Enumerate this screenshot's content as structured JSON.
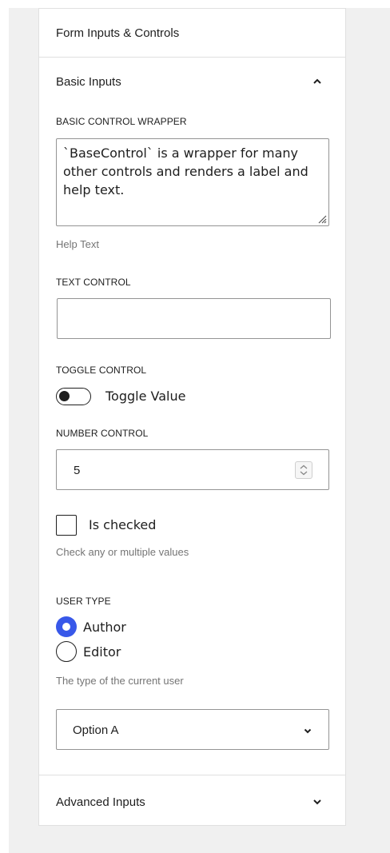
{
  "panel": {
    "title": "Form Inputs & Controls"
  },
  "basic_inputs": {
    "title": "Basic Inputs",
    "expanded": true,
    "base_control": {
      "label": "BASIC CONTROL WRAPPER",
      "value": "`BaseControl` is a wrapper for many other controls and renders a label and help text.",
      "help": "Help Text"
    },
    "text_control": {
      "label": "TEXT CONTROL",
      "value": ""
    },
    "toggle_control": {
      "label": "TOGGLE CONTROL",
      "toggle_label": "Toggle Value",
      "checked": false
    },
    "number_control": {
      "label": "NUMBER CONTROL",
      "value": "5"
    },
    "checkbox": {
      "label": "Is checked",
      "help": "Check any or multiple values",
      "checked": false
    },
    "user_type": {
      "label": "USER TYPE",
      "options": [
        {
          "label": "Author",
          "checked": true
        },
        {
          "label": "Editor",
          "checked": false
        }
      ],
      "help": "The type of the current user"
    },
    "select": {
      "value": "Option A"
    }
  },
  "advanced_inputs": {
    "title": "Advanced Inputs",
    "expanded": false
  },
  "icons": {
    "collapse": "chevron-up-icon",
    "expand": "chevron-down-icon",
    "resize": "resize-grip-icon",
    "spinner": "number-spinner-icon"
  },
  "colors": {
    "accent": "#3858e9",
    "border": "#949494",
    "help_text": "#757575",
    "panel_border": "#e0e0e0"
  }
}
